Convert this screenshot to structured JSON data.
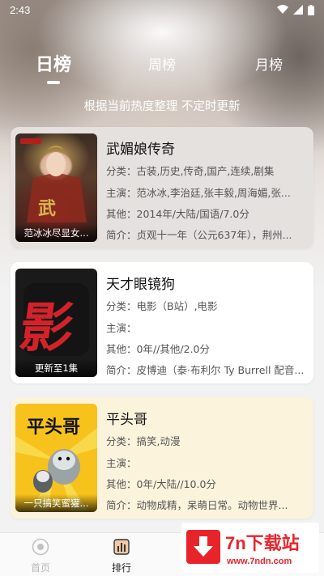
{
  "status_bar": {
    "time": "2:43"
  },
  "tabs": [
    {
      "label": "日榜",
      "active": true
    },
    {
      "label": "周榜",
      "active": false
    },
    {
      "label": "月榜",
      "active": false
    }
  ],
  "subtitle": "根据当前热度整理 不定时更新",
  "cards": [
    {
      "title": "武媚娘传奇",
      "poster_caption": "范冰冰尽显女...",
      "category": "分类：古装,历史,传奇,国产,连续,剧集",
      "cast": "主演：范冰冰,李治廷,张丰毅,周海媚,张...",
      "other": "其他：2014年/大陆/国语/7.0分",
      "intro": "简介：贞观十一年（公元637年），荆州...",
      "bg": "#e4e1df"
    },
    {
      "title": "天才眼镜狗",
      "poster_caption": "更新至1集",
      "category": "分类：电影（B站）,电影",
      "cast": "主演：",
      "other": "其他：0年//其他/2.0分",
      "intro": "简介：皮博迪（泰·布利尔 Ty Burrell 配音...",
      "bg": "#ffffff"
    },
    {
      "title": "平头哥",
      "poster_caption": "一只搞笑蜜獾...",
      "category": "分类：搞笑,动漫",
      "cast": "主演：",
      "other": "其他：0年/大陆//10.0分",
      "intro": "简介：动物成精，呆萌日常。动物世界...",
      "bg": "#fbf3dc"
    }
  ],
  "bottom_nav": {
    "home_label": "首页",
    "rank_label": "排行"
  },
  "watermark": {
    "title": "7n下载站",
    "url": "www.7ndn.com"
  }
}
